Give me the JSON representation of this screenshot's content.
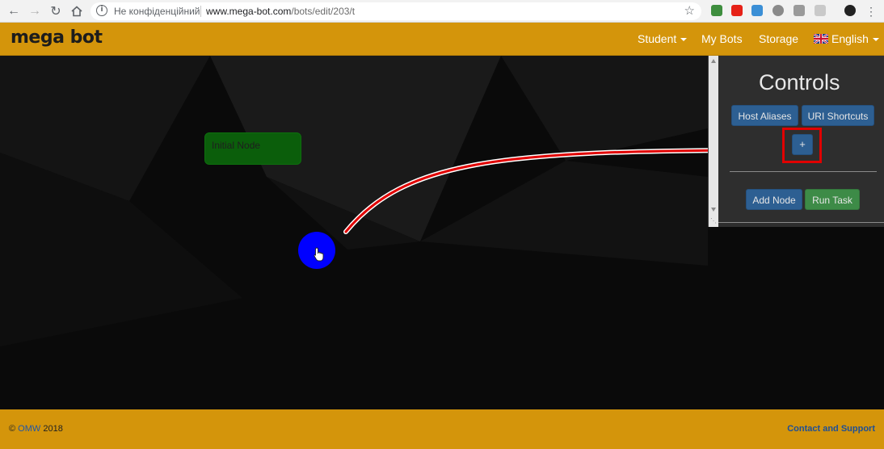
{
  "browser": {
    "security_text": "Не конфіденційний",
    "url_host": "www.mega-bot.com",
    "url_path": "/bots/edit/203/t",
    "icons": [
      "back-icon",
      "forward-icon",
      "reload-icon",
      "home-icon",
      "info-icon",
      "star-icon",
      "menu-dots-icon"
    ]
  },
  "site": {
    "logo": "mega bot",
    "nav": {
      "student": "Student",
      "my_bots": "My Bots",
      "storage": "Storage",
      "language": "English"
    }
  },
  "canvas": {
    "node_label": "Initial Node"
  },
  "controls": {
    "title": "Controls",
    "host_aliases": "Host Aliases",
    "uri_shortcuts": "URI Shortcuts",
    "plus": "+",
    "add_node": "Add Node",
    "run_task": "Run Task"
  },
  "footer": {
    "copyright_symbol": "©",
    "company": "OMW",
    "year": "2018",
    "contact": "Contact and Support"
  },
  "colors": {
    "brand": "#d4950b",
    "btn_blue": "#2d5f92",
    "btn_green": "#3d8b47",
    "node_green": "#0b5e0b",
    "highlight_red": "#e10000",
    "cursor_blue": "#0000ff"
  }
}
